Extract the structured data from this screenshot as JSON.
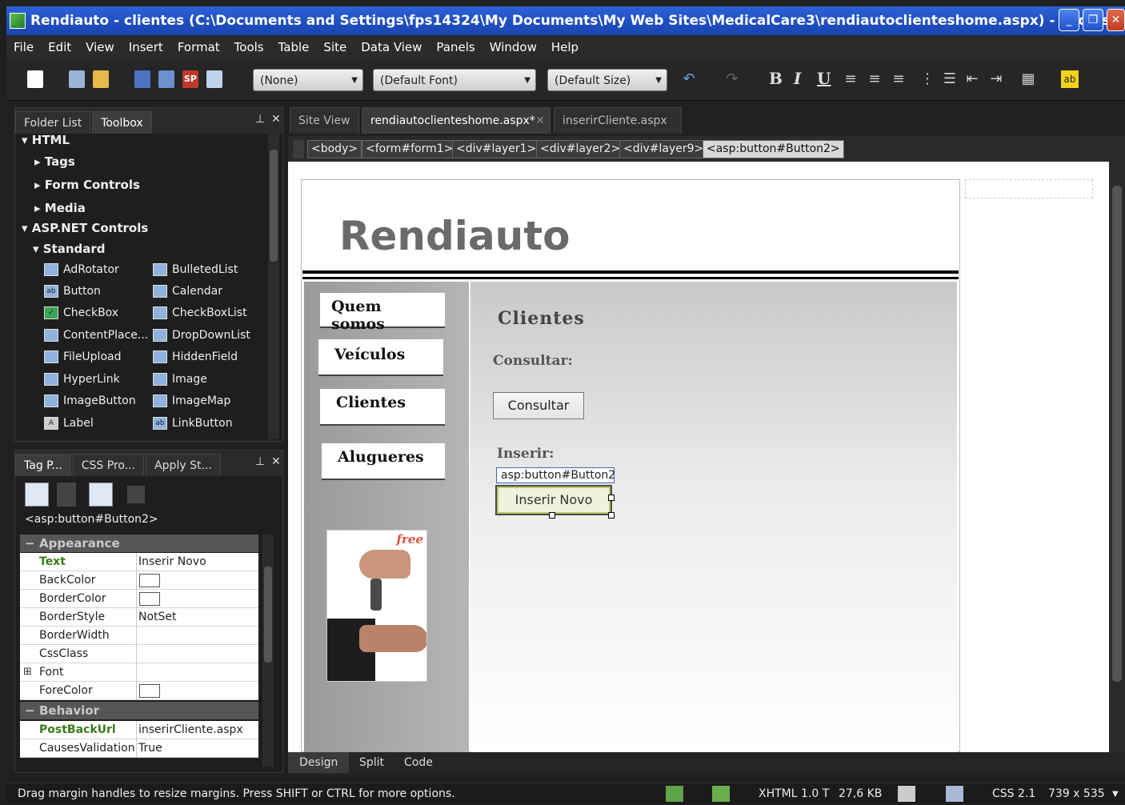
{
  "window": {
    "title": "Rendiauto - clientes (C:\\Documents and Settings\\fps14324\\My Documents\\My Web Sites\\MedicalCare3\\rendiautoclienteshome.aspx) - Microsoft Expr..."
  },
  "menu": [
    "File",
    "Edit",
    "View",
    "Insert",
    "Format",
    "Tools",
    "Table",
    "Site",
    "Data View",
    "Panels",
    "Window",
    "Help"
  ],
  "toolbar": {
    "style_select": "(None)",
    "font_select": "(Default Font)",
    "size_select": "(Default Size)",
    "bold": "B",
    "italic": "I",
    "underline": "U"
  },
  "toolbox_panel": {
    "tabs": [
      "Folder List",
      "Toolbox"
    ],
    "tree": {
      "html": "HTML",
      "tags": "Tags",
      "form_controls": "Form Controls",
      "media": "Media",
      "aspnet": "ASP.NET Controls",
      "standard": "Standard"
    },
    "controls": [
      [
        "AdRotator",
        "BulletedList"
      ],
      [
        "Button",
        "Calendar"
      ],
      [
        "CheckBox",
        "CheckBoxList"
      ],
      [
        "ContentPlace...",
        "DropDownList"
      ],
      [
        "FileUpload",
        "HiddenField"
      ],
      [
        "HyperLink",
        "Image"
      ],
      [
        "ImageButton",
        "ImageMap"
      ],
      [
        "Label",
        "LinkButton"
      ]
    ]
  },
  "tag_panel": {
    "tabs": [
      "Tag P...",
      "CSS Pro...",
      "Apply St..."
    ],
    "selected_tag": "<asp:button#Button2>",
    "categories": {
      "appearance": "Appearance",
      "behavior": "Behavior"
    },
    "appearance_props": [
      {
        "name": "Text",
        "value": "Inserir Novo"
      },
      {
        "name": "BackColor",
        "value": ""
      },
      {
        "name": "BorderColor",
        "value": ""
      },
      {
        "name": "BorderStyle",
        "value": "NotSet"
      },
      {
        "name": "BorderWidth",
        "value": ""
      },
      {
        "name": "CssClass",
        "value": ""
      },
      {
        "name": "Font",
        "value": ""
      },
      {
        "name": "ForeColor",
        "value": ""
      }
    ],
    "behavior_props": [
      {
        "name": "PostBackUrl",
        "value": "inserirCliente.aspx"
      },
      {
        "name": "CausesValidation",
        "value": "True"
      }
    ]
  },
  "editor": {
    "doc_tabs": [
      "Site View",
      "rendiautoclienteshome.aspx*",
      "inserirCliente.aspx"
    ],
    "breadcrumbs": [
      "<body>",
      "<form#form1>",
      "<div#layer1>",
      "<div#layer2>",
      "<div#layer9>",
      "<asp:button#Button2>"
    ],
    "view_tabs": [
      "Design",
      "Split",
      "Code"
    ]
  },
  "page": {
    "site_title": "Rendiauto",
    "nav": [
      "Quem somos",
      "Veículos",
      "Clientes",
      "Alugueres"
    ],
    "promo_label": "free",
    "heading": "Clientes",
    "consultar_label": "Consultar:",
    "consultar_button": "Consultar",
    "inserir_label": "Inserir:",
    "selected_tag_label": "asp:button#Button2",
    "inserir_button": "Inserir Novo"
  },
  "status": {
    "message": "Drag margin handles to resize margins. Press SHIFT or CTRL for more options.",
    "doctype": "XHTML 1.0 T",
    "size": "27,6 KB",
    "css": "CSS 2.1",
    "dimensions": "739 x 535"
  }
}
